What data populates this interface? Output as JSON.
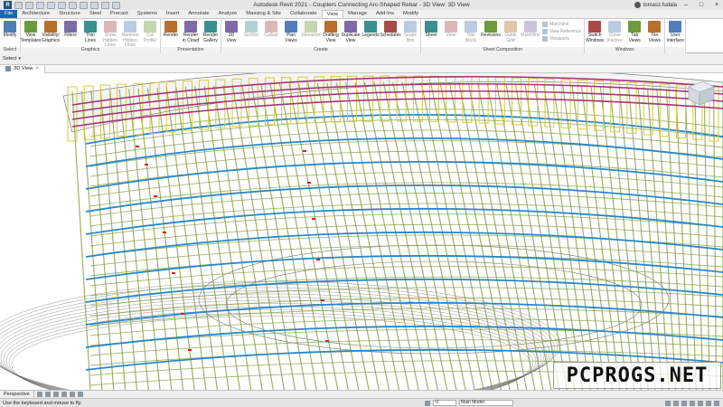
{
  "window": {
    "title": "Autodesk Revit 2021 - Couplers Connecting Arc-Shaped Rebar - 3D View: 3D View",
    "user": "tomasz.fudala"
  },
  "tabs": [
    "File",
    "Architecture",
    "Structure",
    "Steel",
    "Precast",
    "Systems",
    "Insert",
    "Annotate",
    "Analyze",
    "Massing & Site",
    "Collaborate",
    "View",
    "Manage",
    "Add-Ins",
    "Modify"
  ],
  "active_tab": "View",
  "ribbon": {
    "groups": [
      {
        "name": "Select",
        "buttons": [
          {
            "label": "Modify",
            "icon": "modify-cursor-icon",
            "enabled": true
          }
        ]
      },
      {
        "name": "Graphics",
        "buttons": [
          {
            "label": "View\nTemplates",
            "icon": "view-templates-icon",
            "enabled": true
          },
          {
            "label": "Visibility/\nGraphics",
            "icon": "visibility-graphics-icon",
            "enabled": true
          },
          {
            "label": "Filters",
            "icon": "filters-icon",
            "enabled": true
          },
          {
            "label": "Thin\nLines",
            "icon": "thin-lines-icon",
            "enabled": true
          },
          {
            "label": "Show\nHidden Lines",
            "icon": "show-hidden-lines-icon",
            "enabled": false
          },
          {
            "label": "Remove\nHidden Lines",
            "icon": "remove-hidden-lines-icon",
            "enabled": false
          },
          {
            "label": "Cut\nProfile",
            "icon": "cut-profile-icon",
            "enabled": false
          }
        ]
      },
      {
        "name": "Presentation",
        "buttons": [
          {
            "label": "Render",
            "icon": "render-icon",
            "enabled": true
          },
          {
            "label": "Render\nin Cloud",
            "icon": "render-cloud-icon",
            "enabled": true
          },
          {
            "label": "Render\nGallery",
            "icon": "render-gallery-icon",
            "enabled": true
          }
        ]
      },
      {
        "name": "Create",
        "buttons": [
          {
            "label": "3D\nView",
            "icon": "3d-view-icon",
            "enabled": true
          },
          {
            "label": "Section",
            "icon": "section-icon",
            "enabled": false
          },
          {
            "label": "Callout",
            "icon": "callout-icon",
            "enabled": false
          },
          {
            "label": "Plan\nViews",
            "icon": "plan-views-icon",
            "enabled": true
          },
          {
            "label": "Elevation",
            "icon": "elevation-icon",
            "enabled": false
          },
          {
            "label": "Drafting\nView",
            "icon": "drafting-view-icon",
            "enabled": true
          },
          {
            "label": "Duplicate\nView",
            "icon": "duplicate-view-icon",
            "enabled": true
          },
          {
            "label": "Legends",
            "icon": "legends-icon",
            "enabled": true
          },
          {
            "label": "Schedules",
            "icon": "schedules-icon",
            "enabled": true
          },
          {
            "label": "Scope\nBox",
            "icon": "scope-box-icon",
            "enabled": false
          }
        ]
      },
      {
        "name": "Sheet Composition",
        "buttons": [
          {
            "label": "Sheet",
            "icon": "sheet-icon",
            "enabled": true
          },
          {
            "label": "View",
            "icon": "view-placement-icon",
            "enabled": false
          },
          {
            "label": "Title\nBlock",
            "icon": "title-block-icon",
            "enabled": false
          },
          {
            "label": "Revisions",
            "icon": "revisions-icon",
            "enabled": true
          },
          {
            "label": "Guide\nGrid",
            "icon": "guide-grid-icon",
            "enabled": false
          },
          {
            "label": "Matchline",
            "icon": "matchline-icon",
            "enabled": false
          }
        ],
        "small": [
          "Matchline",
          "View Reference",
          "Viewports"
        ]
      },
      {
        "name": "Windows",
        "buttons": [
          {
            "label": "Switch\nWindows",
            "icon": "switch-windows-icon",
            "enabled": true
          },
          {
            "label": "Close\nInactive",
            "icon": "close-inactive-icon",
            "enabled": false
          },
          {
            "label": "Tab\nViews",
            "icon": "tab-views-icon",
            "enabled": true
          },
          {
            "label": "Tile\nViews",
            "icon": "tile-views-icon",
            "enabled": true
          }
        ]
      },
      {
        "name": "",
        "buttons": [
          {
            "label": "User\nInterface",
            "icon": "user-interface-icon",
            "enabled": true
          }
        ]
      }
    ]
  },
  "select_label": "Select",
  "view_tab": {
    "label": "3D View",
    "close": "×"
  },
  "view_control": {
    "label": "Perspective"
  },
  "status": {
    "message": "Use the keyboard and mouse to fly.",
    "workset_value": ":0",
    "model": "Main Model"
  },
  "watermark": "PCPROGS.NET",
  "colors": {
    "file_tab": "#1f63b5",
    "rebar_blue": "#2a87c9",
    "rebar_green": "#7a9a3a",
    "rebar_yellow": "#d6c93a",
    "rebar_magenta": "#a8327a",
    "coupler_red": "#d62020"
  }
}
